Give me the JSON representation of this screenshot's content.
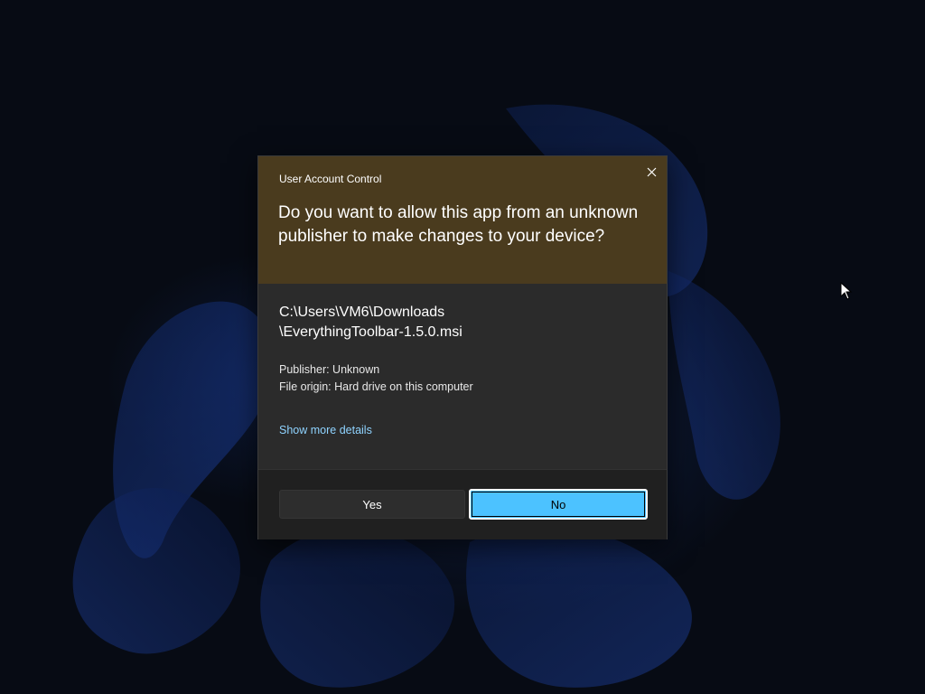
{
  "dialog": {
    "caption": "User Account Control",
    "question": "Do you want to allow this app from an unknown publisher to make changes to your device?",
    "path_line1": "C:\\Users\\VM6\\Downloads",
    "path_line2": "\\EverythingToolbar-1.5.0.msi",
    "publisher": "Publisher: Unknown",
    "file_origin": "File origin: Hard drive on this computer",
    "details_link": "Show more details",
    "close_icon": "close-icon"
  },
  "buttons": {
    "yes_label": "Yes",
    "no_label": "No"
  },
  "colors": {
    "header_bg": "#4a3b1e",
    "body_bg": "#2b2b2b",
    "footer_bg": "#202020",
    "accent": "#4cc2ff",
    "link": "#8fd3ff"
  }
}
